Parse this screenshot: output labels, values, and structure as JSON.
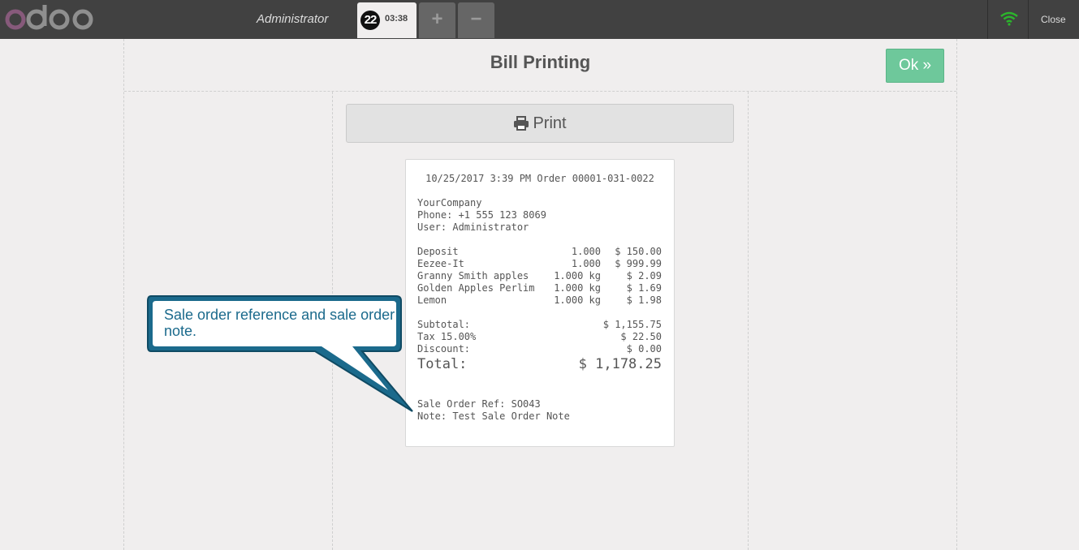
{
  "header": {
    "logo_text": "odoo",
    "user": "Administrator",
    "order_number": "22",
    "order_time": "03:38",
    "add_label": "+",
    "remove_label": "−",
    "close_label": "Close"
  },
  "screen": {
    "title": "Bill Printing",
    "ok_label": "Ok »",
    "print_label": "Print"
  },
  "receipt": {
    "header_line": "10/25/2017 3:39 PM Order 00001-031-0022",
    "company": "YourCompany",
    "phone": "Phone: +1 555 123 8069",
    "user": "User: Administrator",
    "lines": [
      {
        "name": "Deposit",
        "qty": "1.000",
        "amount": "$ 150.00"
      },
      {
        "name": "Eezee-It",
        "qty": "1.000",
        "amount": "$ 999.99"
      },
      {
        "name": "Granny Smith apples",
        "qty": "1.000 kg",
        "amount": "$ 2.09"
      },
      {
        "name": "Golden Apples Perlim",
        "qty": "1.000 kg",
        "amount": "$ 1.69"
      },
      {
        "name": "Lemon",
        "qty": "1.000 kg",
        "amount": "$ 1.98"
      }
    ],
    "subtotal_label": "Subtotal:",
    "subtotal": "$ 1,155.75",
    "tax_label": "Tax 15.00%",
    "tax": "$ 22.50",
    "discount_label": "Discount:",
    "discount": "$ 0.00",
    "total_label": "Total:",
    "total": "$ 1,178.25",
    "sale_order_ref": "Sale Order Ref: SO043",
    "note": "Note: Test Sale Order Note"
  },
  "callout": {
    "text": "Sale order reference and sale order note."
  },
  "colors": {
    "topbar": "#414141",
    "ok_green": "#6ec89b",
    "callout_blue": "#1b6a8c",
    "wifi_green": "#2cb52c"
  }
}
